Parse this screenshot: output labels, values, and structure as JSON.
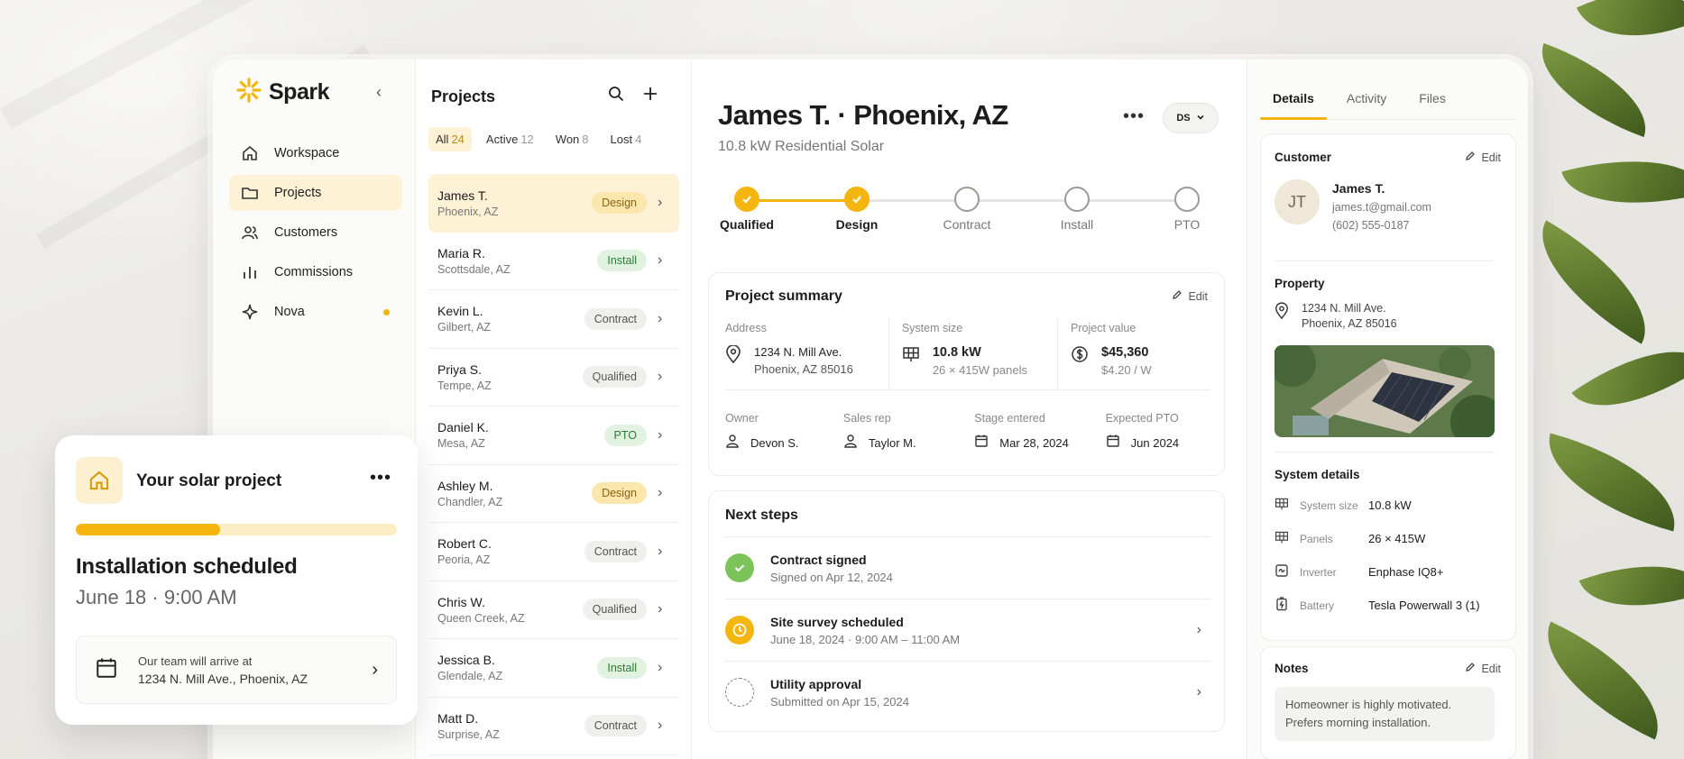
{
  "brand": {
    "name": "Spark"
  },
  "nav": [
    {
      "label": "Workspace",
      "icon": "home-icon",
      "active": false
    },
    {
      "label": "Projects",
      "icon": "folder-icon",
      "active": true
    },
    {
      "label": "Customers",
      "icon": "users-icon",
      "active": false
    },
    {
      "label": "Commissions",
      "icon": "bar-chart-icon",
      "active": false
    },
    {
      "label": "Nova",
      "icon": "sparkle-icon",
      "active": false
    }
  ],
  "projects": {
    "title": "Projects",
    "filters": [
      {
        "label": "All",
        "count": "24"
      },
      {
        "label": "Active",
        "count": "12"
      },
      {
        "label": "Won",
        "count": "8"
      },
      {
        "label": "Lost",
        "count": "4"
      }
    ],
    "rows": [
      {
        "name": "James T.",
        "loc": "Phoenix, AZ",
        "stage": "Design"
      },
      {
        "name": "Maria R.",
        "loc": "Scottsdale, AZ",
        "stage": "Install"
      },
      {
        "name": "Kevin L.",
        "loc": "Gilbert, AZ",
        "stage": "Contract"
      },
      {
        "name": "Priya S.",
        "loc": "Tempe, AZ",
        "stage": "Qualified"
      },
      {
        "name": "Daniel K.",
        "loc": "Mesa, AZ",
        "stage": "PTO"
      },
      {
        "name": "Ashley M.",
        "loc": "Chandler, AZ",
        "stage": "Design"
      },
      {
        "name": "Robert C.",
        "loc": "Peoria, AZ",
        "stage": "Contract"
      },
      {
        "name": "Chris W.",
        "loc": "Queen Creek, AZ",
        "stage": "Qualified"
      },
      {
        "name": "Jessica B.",
        "loc": "Glendale, AZ",
        "stage": "Install"
      },
      {
        "name": "Matt D.",
        "loc": "Surprise, AZ",
        "stage": "Contract"
      }
    ]
  },
  "detail": {
    "title": "James T. · Phoenix, AZ",
    "subtitle": "10.8 kW Residential Solar",
    "user_initials": "DS",
    "steps": [
      {
        "label": "Qualified",
        "done": true
      },
      {
        "label": "Design",
        "done": true
      },
      {
        "label": "Contract",
        "done": false
      },
      {
        "label": "Install",
        "done": false
      },
      {
        "label": "PTO",
        "done": false
      }
    ],
    "summary": {
      "title": "Project summary",
      "edit": "Edit",
      "address_label": "Address",
      "address_line1": "1234 N. Mill Ave.",
      "address_line2": "Phoenix, AZ 85016",
      "size_label": "System size",
      "size_value": "10.8 kW",
      "size_sub": "26 × 415W panels",
      "value_label": "Project value",
      "value_value": "$45,360",
      "value_sub": "$4.20 / W",
      "owner_label": "Owner",
      "owner_value": "Devon S.",
      "rep_label": "Sales rep",
      "rep_value": "Taylor M.",
      "stage_label": "Stage entered",
      "stage_value": "Mar 28, 2024",
      "pto_label": "Expected PTO",
      "pto_value": "Jun 2024"
    },
    "next_steps": {
      "title": "Next steps",
      "items": [
        {
          "title": "Contract signed",
          "sub": "Signed on Apr 12, 2024",
          "status": "done"
        },
        {
          "title": "Site survey scheduled",
          "sub": "June 18, 2024 · 9:00 AM – 11:00 AM",
          "status": "scheduled"
        },
        {
          "title": "Utility approval",
          "sub": "Submitted on Apr 15, 2024",
          "status": "pending"
        }
      ]
    }
  },
  "right": {
    "tabs": [
      "Details",
      "Activity",
      "Files"
    ],
    "customer": {
      "title": "Customer",
      "edit": "Edit",
      "initials": "JT",
      "name": "James T.",
      "email": "james.t@gmail.com",
      "phone": "(602) 555-0187"
    },
    "property": {
      "title": "Property",
      "line1": "1234 N. Mill Ave.",
      "line2": "Phoenix, AZ 85016"
    },
    "system": {
      "title": "System details",
      "rows": [
        {
          "k": "System size",
          "v": "10.8 kW"
        },
        {
          "k": "Panels",
          "v": "26 × 415W"
        },
        {
          "k": "Inverter",
          "v": "Enphase IQ8+"
        },
        {
          "k": "Battery",
          "v": "Tesla Powerwall 3 (1)"
        }
      ]
    },
    "notes": {
      "title": "Notes",
      "edit": "Edit",
      "line1": "Homeowner is highly motivated.",
      "line2": "Prefers morning installation."
    }
  },
  "float_card": {
    "title": "Your solar project",
    "progress_fraction": 0.45,
    "heading": "Installation scheduled",
    "when": "June 18 · 9:00 AM",
    "arrive_label": "Our team will arrive at",
    "arrive_address": "1234 N. Mill Ave., Phoenix, AZ"
  },
  "colors": {
    "accent": "#f5b50f",
    "accent_soft": "#fdf1d6",
    "success": "#7cc35a"
  }
}
